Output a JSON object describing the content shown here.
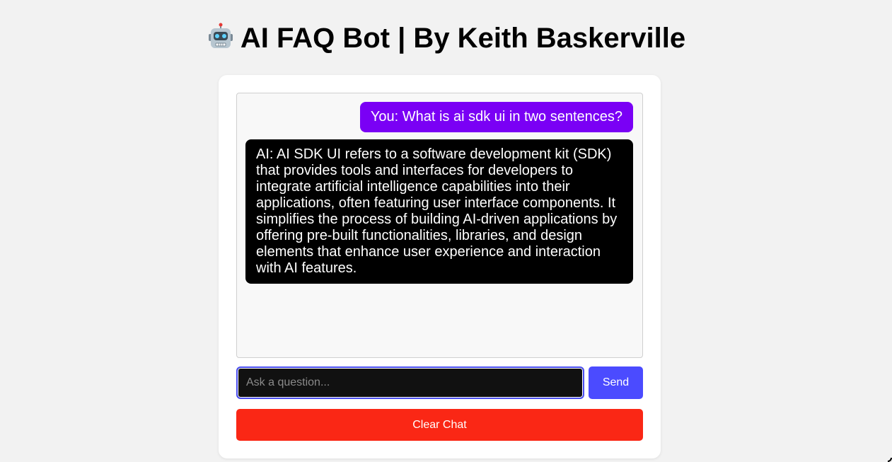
{
  "header": {
    "title": "AI FAQ Bot | By Keith Baskerville",
    "icon": "robot-icon"
  },
  "chat": {
    "messages": [
      {
        "role": "user",
        "text": "You: What is ai sdk ui in two sentences?"
      },
      {
        "role": "ai",
        "text": "AI: AI SDK UI refers to a software development kit (SDK) that provides tools and interfaces for developers to integrate artificial intelligence capabilities into their applications, often featuring user interface components. It simplifies the process of building AI-driven applications by offering pre-built functionalities, libraries, and design elements that enhance user experience and interaction with AI features."
      }
    ]
  },
  "composer": {
    "placeholder": "Ask a question...",
    "value": "",
    "send_label": "Send",
    "clear_label": "Clear Chat"
  },
  "colors": {
    "user_bubble": "#7a00f5",
    "ai_bubble": "#000000",
    "send_button": "#4b4bff",
    "clear_button": "#fa2715",
    "page_background": "#f2f2f2"
  }
}
